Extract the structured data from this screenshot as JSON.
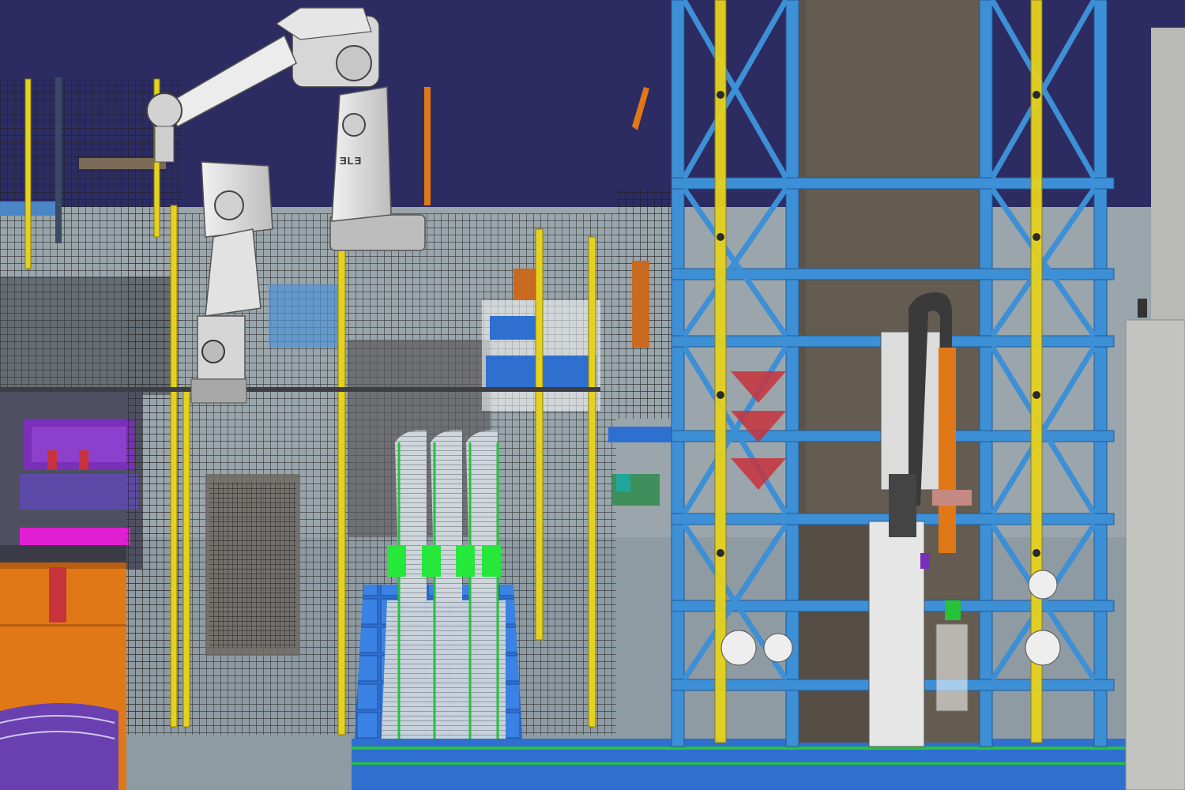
{
  "scene": {
    "robot_large": {
      "logo": "ƎLƎ"
    },
    "colors": {
      "sky": "#2c2c63",
      "floor": "#8e9aa2",
      "back_wall": "#9aa7ad",
      "steel_blue": "#3d8fd6",
      "yellow_post": "#e6d21e",
      "orange_cabinet": "#e07818",
      "mesh": "#2a2a2a",
      "robot_white": "#dcdcdc",
      "conveyor_blue": "#2f6fd0",
      "accent_green": "#25c23a",
      "accent_purple": "#7a2fb8",
      "accent_red": "#c8323c"
    },
    "icons": [
      "robot-arm-icon",
      "conveyor-icon",
      "tower-frame-icon",
      "fence-icon"
    ]
  }
}
